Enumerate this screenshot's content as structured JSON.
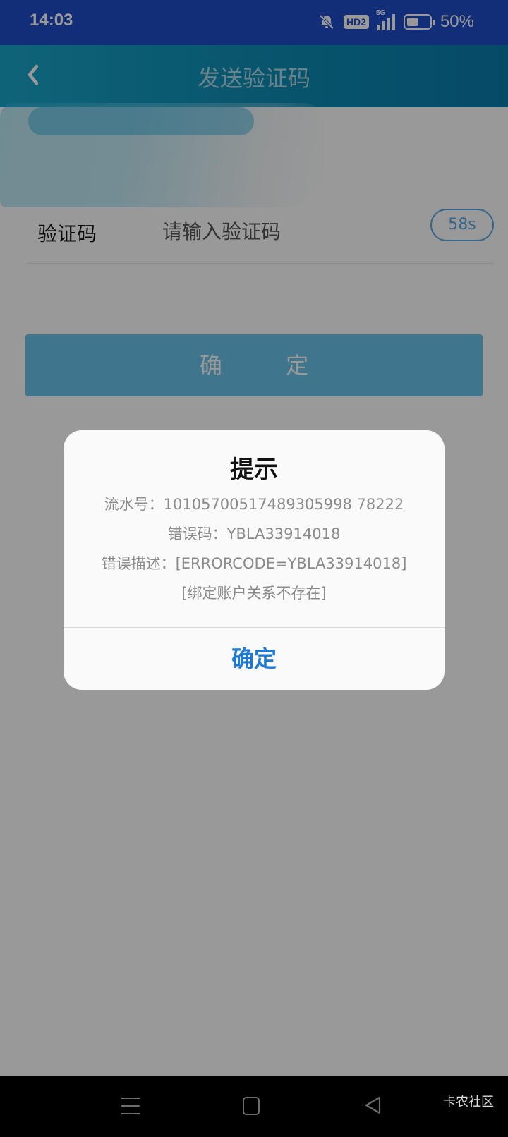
{
  "status_bar": {
    "time": "14:03",
    "hd_label": "HD2",
    "network_label": "5G",
    "battery_text": "50%",
    "battery_level": 0.5
  },
  "app_bar": {
    "title": "发送验证码"
  },
  "form": {
    "code_label": "验证码",
    "code_placeholder": "请输入验证码",
    "countdown": "58s",
    "confirm_label": "确 定"
  },
  "dialog": {
    "title": "提示",
    "lines": [
      "流水号：10105700517489305998 78222",
      "错误码：YBLA33914018",
      "错误描述：[ERRORCODE=YBLA33914018]",
      "[绑定账户关系不存在]"
    ],
    "ok_label": "确定"
  },
  "watermark": "卡农社区",
  "colors": {
    "status_bar": "#1f4ec8",
    "accent": "#1f78d1",
    "button": "#6ac4ec"
  }
}
